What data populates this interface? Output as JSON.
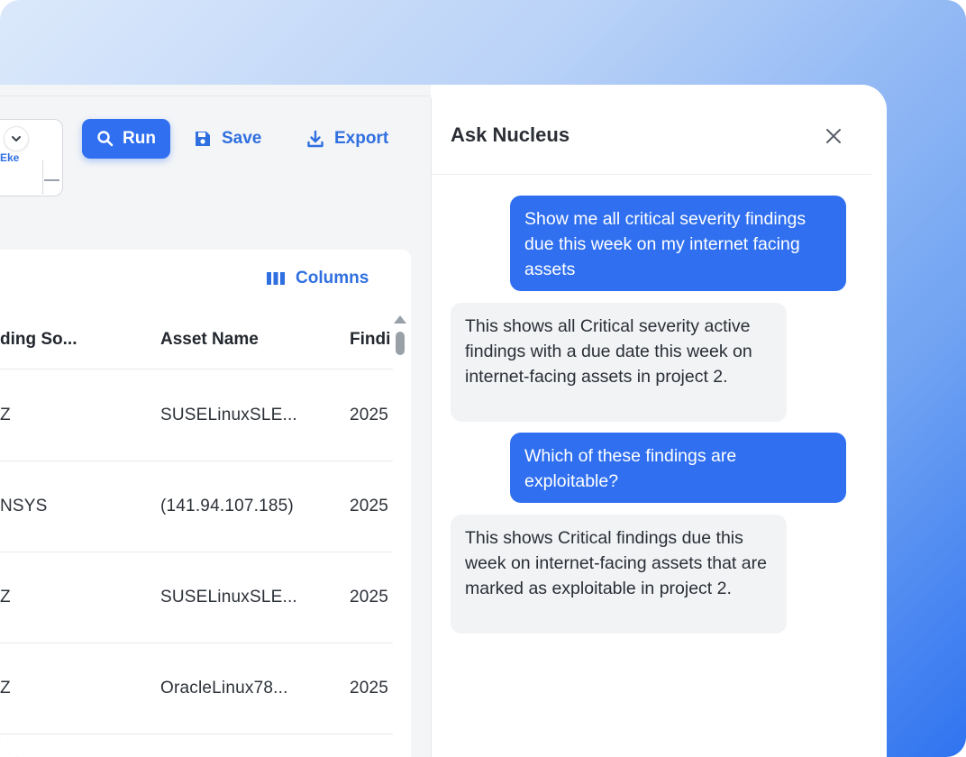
{
  "toolbar": {
    "field_text": "Eke",
    "run_label": "Run",
    "save_label": "Save",
    "export_label": "Export"
  },
  "table": {
    "columns_button": "Columns",
    "headers": [
      "ding So...",
      "Asset Name",
      "Findi"
    ],
    "rows": [
      {
        "source": "Z",
        "asset": "SUSELinuxSLE...",
        "finding": "2025"
      },
      {
        "source": "NSYS",
        "asset": "(141.94.107.185)",
        "finding": "2025"
      },
      {
        "source": "Z",
        "asset": "SUSELinuxSLE...",
        "finding": "2025"
      },
      {
        "source": "Z",
        "asset": "OracleLinux78...",
        "finding": "2025"
      }
    ]
  },
  "chat": {
    "title": "Ask Nucleus",
    "messages": [
      {
        "role": "user",
        "text": "Show me all critical severity findings due this week on my internet facing assets"
      },
      {
        "role": "assistant",
        "text": "This shows all Critical severity active findings with a due date this week on internet-facing assets in project 2."
      },
      {
        "role": "user",
        "text": "Which of these findings are exploitable?"
      },
      {
        "role": "assistant",
        "text": "This shows Critical findings due this week on internet-facing assets that are marked as exploitable in project 2."
      }
    ]
  },
  "colors": {
    "accent": "#2f6ff0",
    "user_bubble": "#2f6ff0",
    "assistant_bubble": "#f2f3f5"
  }
}
